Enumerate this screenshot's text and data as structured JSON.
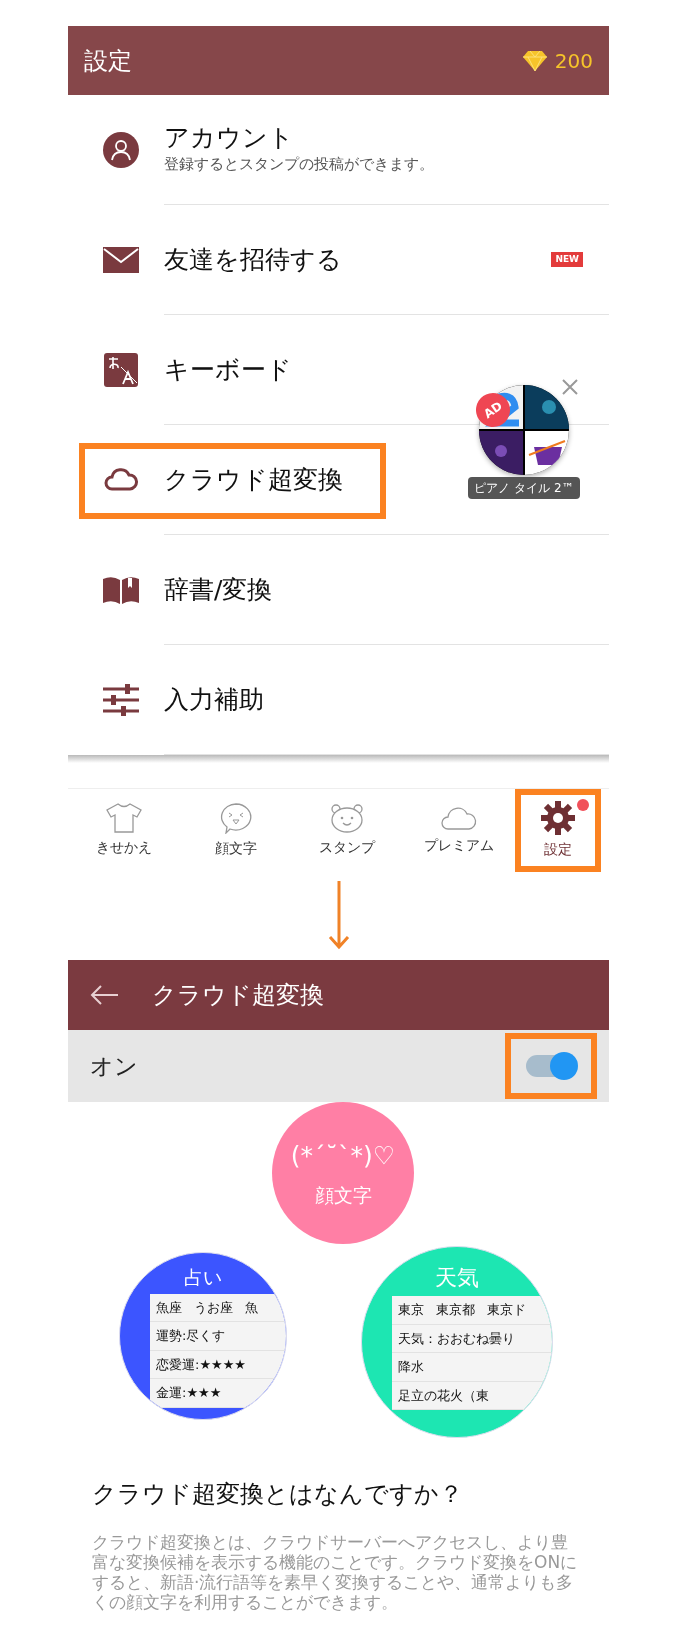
{
  "settings_screen": {
    "header": {
      "title": "設定",
      "gems": "200"
    },
    "menu": [
      {
        "label": "アカウント",
        "subtitle": "登録するとスタンプの投稿ができます。",
        "highlighted": false
      },
      {
        "label": "友達を招待する",
        "badge": "NEW",
        "highlighted": false
      },
      {
        "label": "キーボード",
        "highlighted": false
      },
      {
        "label": "クラウド超変換",
        "highlighted": true
      },
      {
        "label": "辞書/変換",
        "highlighted": false
      },
      {
        "label": "入力補助",
        "highlighted": false
      }
    ],
    "ad": {
      "badge": "AD",
      "label": "ピアノ タイル 2™"
    },
    "bottom_nav": [
      {
        "label": "きせかえ",
        "selected": false,
        "notification": false,
        "highlighted": false
      },
      {
        "label": "顔文字",
        "selected": false,
        "notification": false,
        "highlighted": false
      },
      {
        "label": "スタンプ",
        "selected": false,
        "notification": false,
        "highlighted": false
      },
      {
        "label": "プレミアム",
        "selected": false,
        "notification": false,
        "highlighted": false
      },
      {
        "label": "設定",
        "selected": true,
        "notification": true,
        "highlighted": true
      }
    ]
  },
  "cloud_screen": {
    "header": {
      "title": "クラウド超変換"
    },
    "toggle": {
      "label": "オン",
      "on": true,
      "highlighted": true
    },
    "features": [
      {
        "kind": "bubble",
        "color": "#ff7fa5",
        "face": "(*´˘`*)♡",
        "title": "顔文字"
      },
      {
        "kind": "card",
        "color": "#3c55ff",
        "title": "占い",
        "rows": [
          [
            "魚座",
            "うお座",
            "魚"
          ],
          [
            "運勢:尽くす"
          ],
          [
            "恋愛運:★★★★"
          ],
          [
            "金運:★★★"
          ]
        ]
      },
      {
        "kind": "card",
        "color": "#1de6b2",
        "title": "天気",
        "rows": [
          [
            "東京",
            "東京都",
            "東京ド"
          ],
          [
            "天気：おおむね曇り"
          ],
          [
            "降水"
          ],
          [
            "足立の花火（東"
          ]
        ]
      }
    ],
    "question": "クラウド超変換とはなんですか？",
    "answer": "クラウド超変換とは、クラウドサーバーへアクセスし、より豊富な変換候補を表示する機能のことです。クラウド変換をONにすると、新語·流行語等を素早く変換することや、通常よりも多くの顔文字を利用することができます。"
  }
}
